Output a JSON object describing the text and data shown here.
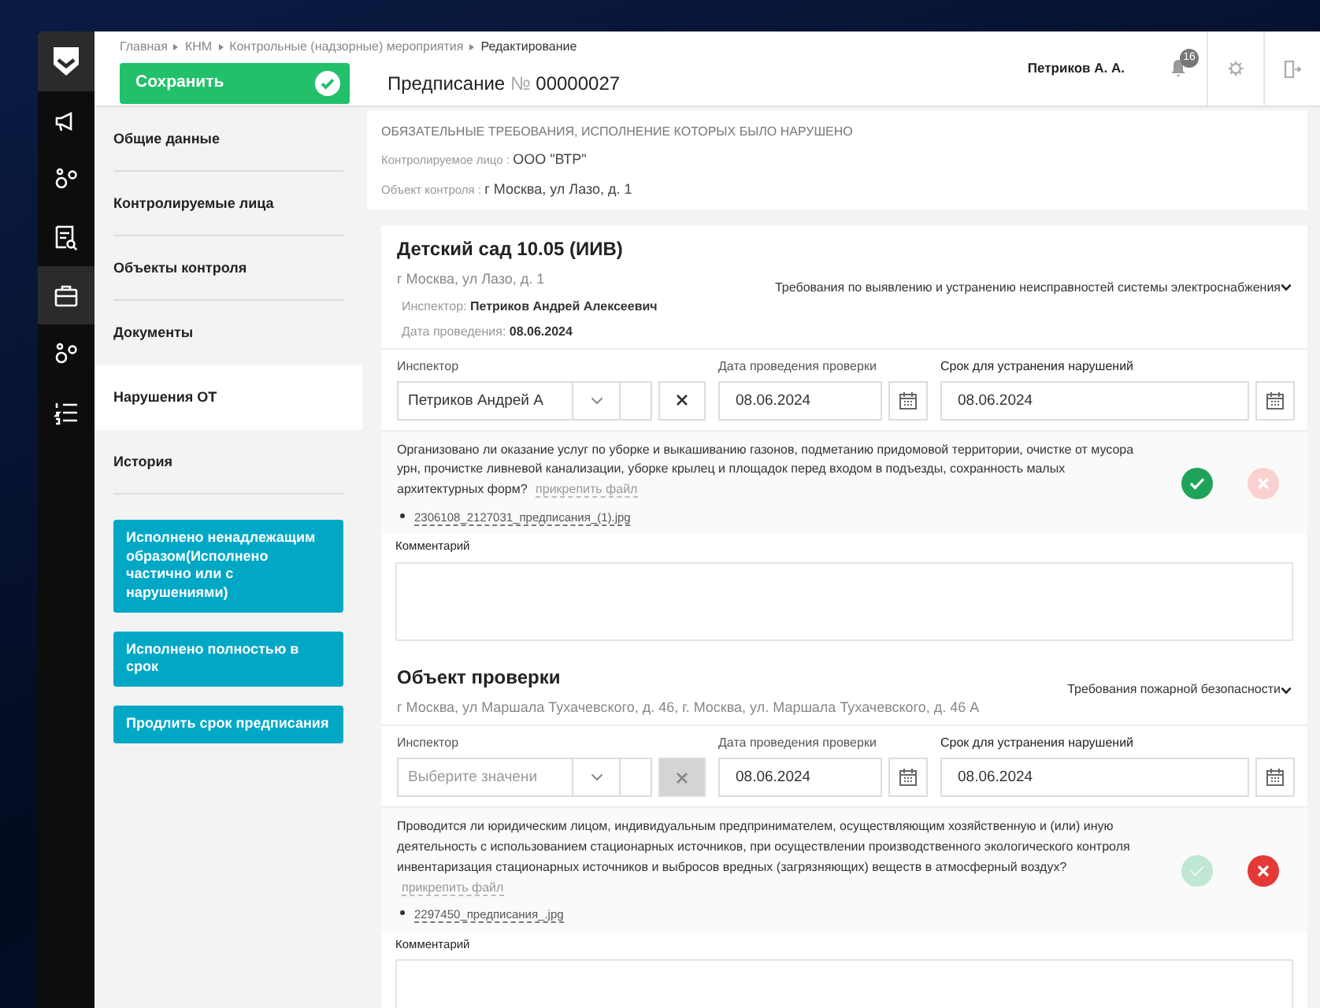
{
  "breadcrumbs": [
    "Главная",
    "КНМ",
    "Контрольные (надзорные) мероприятия",
    "Редактирование"
  ],
  "save_button": "Сохранить",
  "document_title": {
    "label": "Предписание",
    "number_sign": "№",
    "number": "00000027"
  },
  "user_name": "Петриков А. А.",
  "notifications_count": "16",
  "rail": [
    {
      "selected": false
    },
    {
      "selected": false
    },
    {
      "selected": false
    },
    {
      "selected": true
    },
    {
      "selected": false
    },
    {
      "selected": false
    }
  ],
  "nav": [
    {
      "label": "Общие данные",
      "selected": false
    },
    {
      "label": "Контролируемые лица",
      "selected": false
    },
    {
      "label": "Объекты контроля",
      "selected": false
    },
    {
      "label": "Документы",
      "selected": false
    },
    {
      "label": "Нарушения ОТ",
      "selected": true
    },
    {
      "label": "История",
      "selected": false
    }
  ],
  "action_buttons": [
    "Исполнено ненадлежащим образом(Исполнено частично или с нарушениями)",
    "Исполнено полностью в срок",
    "Продлить срок предписания"
  ],
  "summary": {
    "title": "ОБЯЗАТЕЛЬНЫЕ ТРЕБОВАНИЯ, ИСПОЛНЕНИЕ КОТОРЫХ БЫЛО НАРУШЕНО",
    "controlled_person": {
      "label": "Контролируемое лицо :",
      "value": "ООО \"ВТР\""
    },
    "control_object": {
      "label": "Объект контроля :",
      "value": "г Москва, ул Лазо, д. 1"
    }
  },
  "objects": [
    {
      "name": "Детский сад 10.05 (ИИВ)",
      "address": "г Москва, ул Лазо, д. 1",
      "details": [
        {
          "label": "Инспектор:",
          "value": "Петриков Андрей Алексеевич"
        },
        {
          "label": "Дата проведения:",
          "value": "08.06.2024"
        }
      ],
      "requirement": "Требования по выявлению и устранению неисправностей системы электроснабжения",
      "inspector": {
        "label": "Инспектор",
        "value": "Петриков Андрей А",
        "clear_disabled": false
      },
      "inspection_date": {
        "label": "Дата проведения проверки",
        "value": "08.06.2024"
      },
      "deadline": {
        "label": "Срок для устранения нарушений",
        "value": "08.06.2024"
      },
      "question": "Организовано ли оказание услуг по уборке и выкашиванию газонов, подметанию придомовой территории, очистке от мусора урн, прочистке ливневой канализации, уборке крылец и площадок перед входом в подъезды, сохранность малых архитектурных форм?",
      "attach_link": "прикрепить файл",
      "files": [
        "2306108_2127031_предписания_(1).jpg"
      ],
      "check_selected": true,
      "cross_selected": false,
      "comment_label": "Комментарий"
    },
    {
      "name": "Объект проверки",
      "address": "г Москва, ул Маршала Тухачевского, д. 46, г. Москва, ул. Маршала Тухачевского, д. 46 А",
      "requirement": "Требования пожарной безопасности",
      "inspector": {
        "label": "Инспектор",
        "placeholder": "Выберите значени",
        "clear_disabled": true
      },
      "inspection_date": {
        "label": "Дата проведения проверки",
        "value": "08.06.2024"
      },
      "deadline": {
        "label": "Срок для устранения нарушений",
        "value": "08.06.2024"
      },
      "question": "Проводится ли юридическим лицом, индивидуальным предпринимателем, осуществляющим хозяйственную и (или) иную деятельность с использованием стационарных источников, при осуществлении производственного экологического контроля инвентаризация стационарных источников и выбросов вредных (загрязняющих) веществ в атмосферный воздух?",
      "attach_link": "прикрепить файл",
      "files": [
        "2297450_предписания_.jpg"
      ],
      "check_selected": false,
      "cross_selected": true,
      "comment_label": "Комментарий"
    }
  ]
}
